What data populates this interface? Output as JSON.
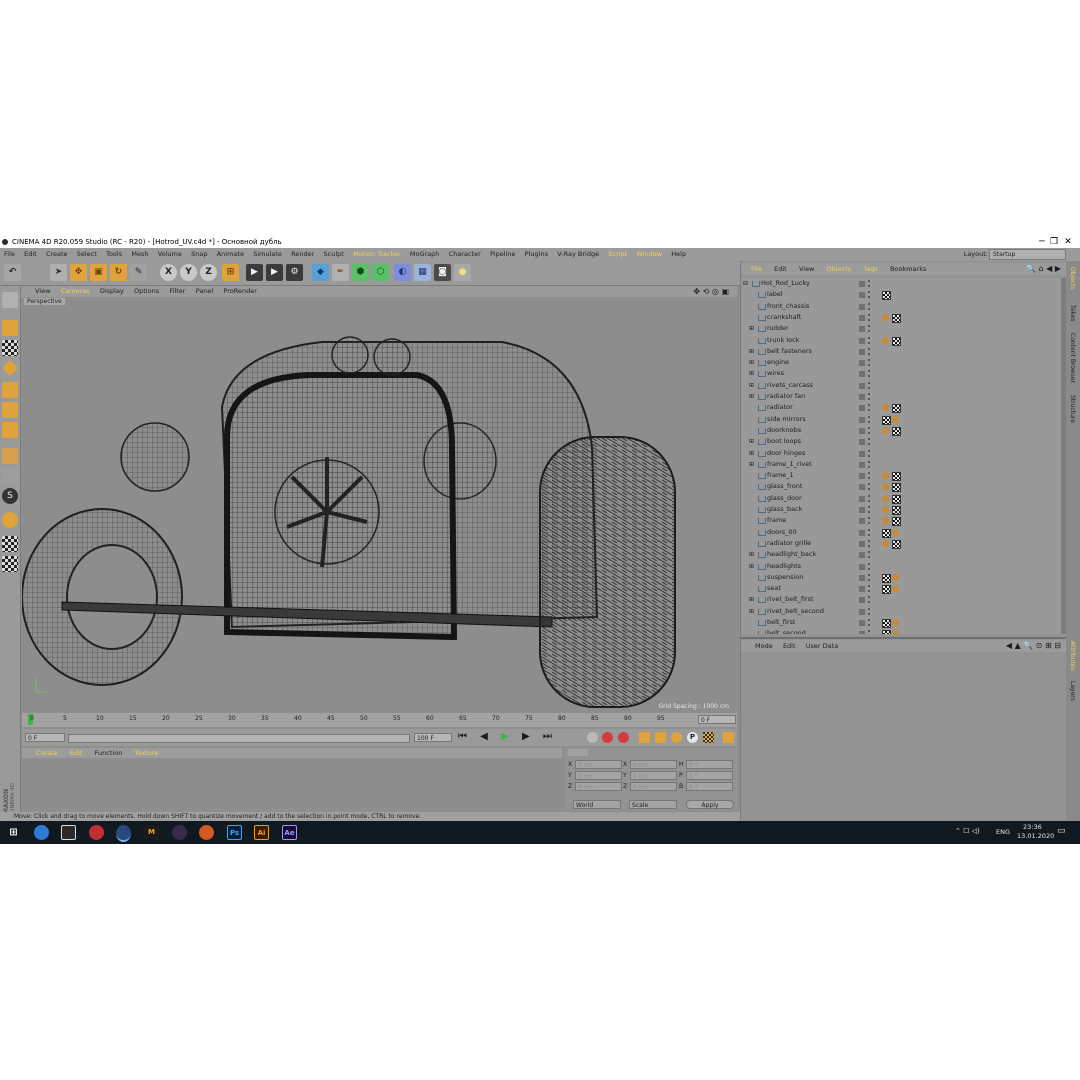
{
  "window": {
    "title": "CINEMA 4D R20.059 Studio (RC - R20) - [Hotrod_UV.c4d *] - Основной дубль",
    "minimize": "─",
    "maximize": "❐",
    "close": "✕"
  },
  "menubar": {
    "items": [
      "File",
      "Edit",
      "Create",
      "Select",
      "Tools",
      "Mesh",
      "Volume",
      "Snap",
      "Animate",
      "Simulate",
      "Render",
      "Sculpt",
      "Motion Tracker",
      "MoGraph",
      "Character",
      "Pipeline",
      "Plugins",
      "V-Ray Bridge",
      "Script",
      "Window",
      "Help"
    ],
    "layout_label": "Layout:",
    "layout_value": "Startup"
  },
  "viewport": {
    "menu": [
      "View",
      "Cameras",
      "Display",
      "Options",
      "Filter",
      "Panel",
      "ProRender"
    ],
    "label": "Perspective",
    "grid_spacing": "Grid Spacing : 1000 cm"
  },
  "timeline": {
    "ticks": [
      "0",
      "5",
      "10",
      "15",
      "20",
      "25",
      "30",
      "35",
      "40",
      "45",
      "50",
      "55",
      "60",
      "65",
      "70",
      "75",
      "80",
      "85",
      "90",
      "95"
    ],
    "frame_field": "0 F",
    "start_field": "0 F",
    "end_field": "100 F"
  },
  "material": {
    "menu": [
      "Create",
      "Edit",
      "Function",
      "Texture"
    ]
  },
  "coords": {
    "rows": [
      [
        "X",
        "0 cm",
        "X",
        "0 cm",
        "H",
        "0 °"
      ],
      [
        "Y",
        "0 cm",
        "Y",
        "0 cm",
        "P",
        "0 °"
      ],
      [
        "Z",
        "0 cm",
        "Z",
        "0 cm",
        "B",
        "0 °"
      ]
    ],
    "mode1": "World",
    "mode2": "Scale",
    "apply": "Apply"
  },
  "status": "Move: Click and drag to move elements. Hold down SHIFT to quantize movement / add to the selection in point mode, CTRL to remove.",
  "objects_panel": {
    "menu": [
      "File",
      "Edit",
      "View",
      "Objects",
      "Tags",
      "Bookmarks"
    ],
    "root": "Hot_Rod_Lucky",
    "items": [
      {
        "name": "label",
        "tags": "c"
      },
      {
        "name": "front_chassis",
        "tags": ""
      },
      {
        "name": "crankshaft",
        "tags": "pc"
      },
      {
        "name": "rudder",
        "tags": ""
      },
      {
        "name": "trunk lock",
        "tags": "pc"
      },
      {
        "name": "belt fasteners",
        "tags": ""
      },
      {
        "name": "engine",
        "tags": ""
      },
      {
        "name": "wires",
        "tags": ""
      },
      {
        "name": "rivets_carcass",
        "tags": ""
      },
      {
        "name": "radiator fan",
        "tags": ""
      },
      {
        "name": "radiator",
        "tags": "pc"
      },
      {
        "name": "side mirrors",
        "tags": "cp"
      },
      {
        "name": "doorknobs",
        "tags": "pc"
      },
      {
        "name": "boot loops",
        "tags": ""
      },
      {
        "name": "door hinges",
        "tags": ""
      },
      {
        "name": "frame_1_rivet",
        "tags": ""
      },
      {
        "name": "frame_1",
        "tags": "pc"
      },
      {
        "name": "glass_front",
        "tags": "pc"
      },
      {
        "name": "glass_door",
        "tags": "pc"
      },
      {
        "name": "glass_back",
        "tags": "pc"
      },
      {
        "name": "frame",
        "tags": "pc"
      },
      {
        "name": "doors_00",
        "tags": "cp"
      },
      {
        "name": "radiator grille",
        "tags": "pc"
      },
      {
        "name": "headlight_back",
        "tags": ""
      },
      {
        "name": "headlights",
        "tags": ""
      },
      {
        "name": "suspension",
        "tags": "cp"
      },
      {
        "name": "seat",
        "tags": "cp"
      },
      {
        "name": "rivet_belt_first",
        "tags": ""
      },
      {
        "name": "rivet_belt_second",
        "tags": ""
      },
      {
        "name": "belt_first",
        "tags": "cp"
      },
      {
        "name": "belt_second",
        "tags": "cp"
      }
    ]
  },
  "attributes_panel": {
    "menu": [
      "Mode",
      "Edit",
      "User Data"
    ]
  },
  "side_tabs": [
    "Objects",
    "Takes",
    "Content Browser",
    "Structure",
    "Attributes",
    "Layers"
  ],
  "brand": {
    "line1": "MAXON",
    "line2": "CINEMA 4D"
  },
  "taskbar": {
    "time": "23:36",
    "date": "13.01.2020",
    "lang": "ENG",
    "apps": [
      "Ps",
      "Ai",
      "Ae"
    ]
  }
}
